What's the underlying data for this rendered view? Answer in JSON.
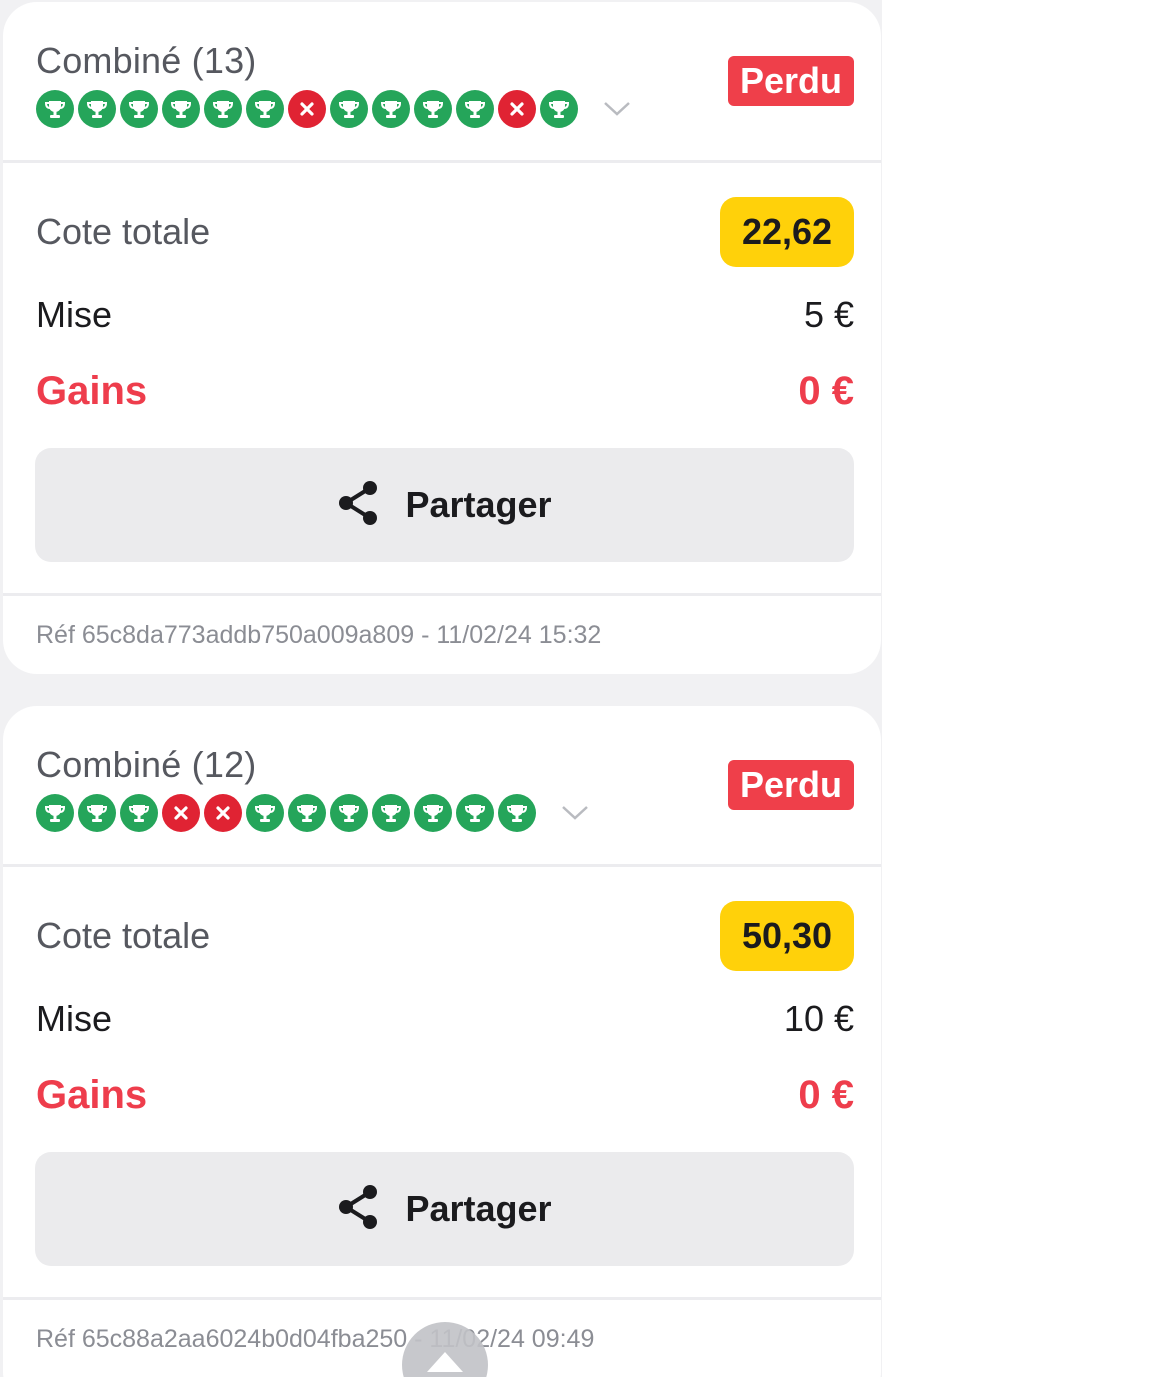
{
  "bets": [
    {
      "title": "Combiné (13)",
      "status": "Perdu",
      "legs": [
        "won",
        "won",
        "won",
        "won",
        "won",
        "won",
        "lost",
        "won",
        "won",
        "won",
        "won",
        "lost",
        "won"
      ],
      "odds_label": "Cote totale",
      "odds_value": "22,62",
      "stake_label": "Mise",
      "stake_value": "5 €",
      "winnings_label": "Gains",
      "winnings_value": "0 €",
      "share_label": "Partager",
      "reference": "Réf 65c8da773addb750a009a809 - 11/02/24 15:32"
    },
    {
      "title": "Combiné (12)",
      "status": "Perdu",
      "legs": [
        "won",
        "won",
        "won",
        "lost",
        "lost",
        "won",
        "won",
        "won",
        "won",
        "won",
        "won",
        "won"
      ],
      "odds_label": "Cote totale",
      "odds_value": "50,30",
      "stake_label": "Mise",
      "stake_value": "10 €",
      "winnings_label": "Gains",
      "winnings_value": "0 €",
      "share_label": "Partager",
      "reference": "Réf 65c88a2aa6024b0d04fba250 - 11/02/24 09:49"
    }
  ],
  "icons": {
    "won_leg": "trophy-icon",
    "lost_leg": "cross-icon",
    "expand": "chevron-down-icon",
    "share": "share-icon",
    "scroll_top": "chevron-up-icon"
  },
  "colors": {
    "won": "#25a55a",
    "lost": "#e02333",
    "status_lost": "#ef3f4a",
    "odds_badge": "#ffd10a",
    "winnings": "#ee3d4c"
  }
}
